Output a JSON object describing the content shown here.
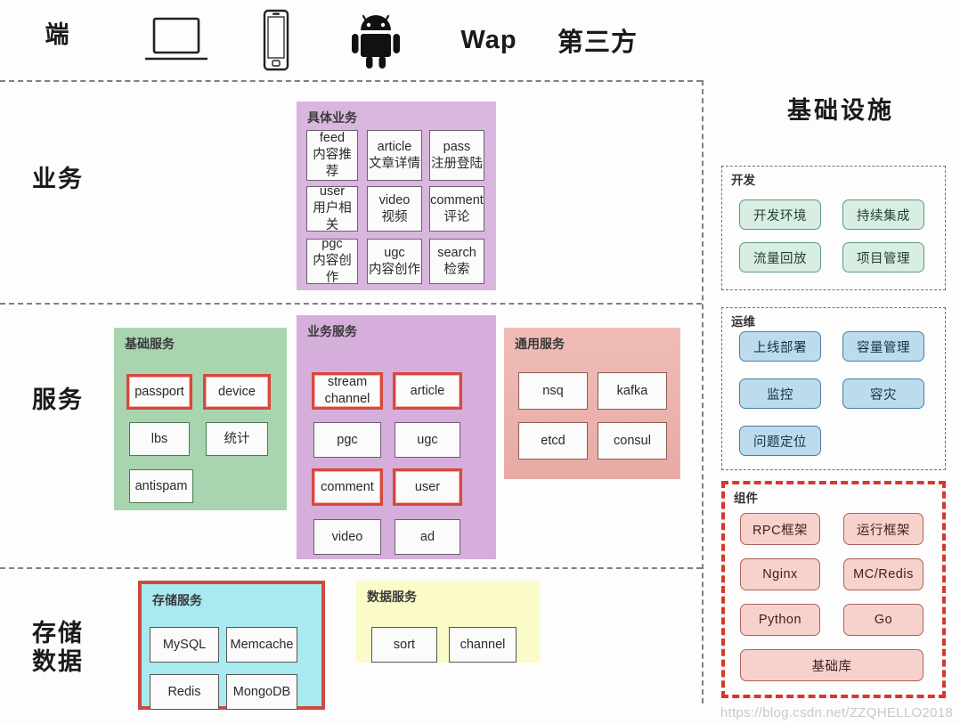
{
  "layers": [
    {
      "label": "端"
    },
    {
      "label": "业务"
    },
    {
      "label": "服务"
    },
    {
      "label": "存储\n数据"
    }
  ],
  "layer_labels": {
    "client": "端",
    "business": "业务",
    "service": "服务",
    "storage_line1": "存储",
    "storage_line2": "数据"
  },
  "clients": [
    {
      "name": "laptop-icon",
      "kind": "icon",
      "label": ""
    },
    {
      "name": "phone-icon",
      "kind": "icon",
      "label": ""
    },
    {
      "name": "android-icon",
      "kind": "icon",
      "label": ""
    },
    {
      "name": "wap-label",
      "kind": "text",
      "label": "Wap"
    },
    {
      "name": "third-party-label",
      "kind": "text",
      "label": "第三方"
    }
  ],
  "business": {
    "group_title": "具体业务",
    "cards": [
      {
        "en": "feed",
        "cn": "内容推荐",
        "highlight": false
      },
      {
        "en": "article",
        "cn": "文章详情",
        "highlight": false
      },
      {
        "en": "pass",
        "cn": "注册登陆",
        "highlight": false
      },
      {
        "en": "user",
        "cn": "用户相关",
        "highlight": false
      },
      {
        "en": "video",
        "cn": "视频",
        "highlight": false
      },
      {
        "en": "comment",
        "cn": "评论",
        "highlight": false
      },
      {
        "en": "pgc",
        "cn": "内容创作",
        "highlight": false
      },
      {
        "en": "ugc",
        "cn": "内容创作",
        "highlight": false
      },
      {
        "en": "search",
        "cn": "检索",
        "highlight": false
      }
    ]
  },
  "service": {
    "basic": {
      "group_title": "基础服务",
      "cards": [
        {
          "en": "passport",
          "highlight": true
        },
        {
          "en": "device",
          "highlight": true
        },
        {
          "en": "lbs",
          "highlight": false
        },
        {
          "en": "统计",
          "highlight": false
        },
        {
          "en": "antispam",
          "highlight": false
        }
      ]
    },
    "business": {
      "group_title": "业务服务",
      "cards": [
        {
          "en": "stream",
          "en2": "channel",
          "highlight": true
        },
        {
          "en": "article",
          "highlight": true
        },
        {
          "en": "pgc",
          "highlight": false
        },
        {
          "en": "ugc",
          "highlight": false
        },
        {
          "en": "comment",
          "highlight": true
        },
        {
          "en": "user",
          "highlight": true
        },
        {
          "en": "video",
          "highlight": false
        },
        {
          "en": "ad",
          "highlight": false
        }
      ]
    },
    "common": {
      "group_title": "通用服务",
      "cards": [
        {
          "en": "nsq",
          "highlight": false
        },
        {
          "en": "kafka",
          "highlight": false
        },
        {
          "en": "etcd",
          "highlight": false
        },
        {
          "en": "consul",
          "highlight": false
        }
      ]
    }
  },
  "storage": {
    "store": {
      "group_title": "存储服务",
      "highlight": true,
      "cards": [
        {
          "en": "MySQL"
        },
        {
          "en": "Memcache"
        },
        {
          "en": "Redis"
        },
        {
          "en": "MongoDB"
        }
      ]
    },
    "data": {
      "group_title": "数据服务",
      "cards": [
        {
          "en": "sort"
        },
        {
          "en": "channel"
        }
      ]
    }
  },
  "infrastructure": {
    "title": "基础设施",
    "sections": [
      {
        "title": "开发",
        "style": "green",
        "items": [
          "开发环境",
          "持续集成",
          "流量回放",
          "项目管理"
        ]
      },
      {
        "title": "运维",
        "style": "blue",
        "items": [
          "上线部署",
          "容量管理",
          "监控",
          "容灾",
          "问题定位"
        ]
      },
      {
        "title": "组件",
        "style": "pink",
        "highlight": true,
        "items": [
          "RPC框架",
          "运行框架",
          "Nginx",
          "MC/Redis",
          "Python",
          "Go",
          "基础库"
        ]
      }
    ]
  },
  "watermark": "https://blog.csdn.net/ZZQHELLO2018",
  "colors": {
    "highlight_red": "#d9473c",
    "business_purple": "#d9b6dd",
    "basic_green": "#a8d5b0",
    "common_pink": "#f0bdb7",
    "storage_cyan": "#a9eaf0",
    "data_yellow": "#fafbc8",
    "dev_green": "#d8eee2",
    "ops_blue": "#bcdcee",
    "comp_pink": "#f7d2cd"
  }
}
